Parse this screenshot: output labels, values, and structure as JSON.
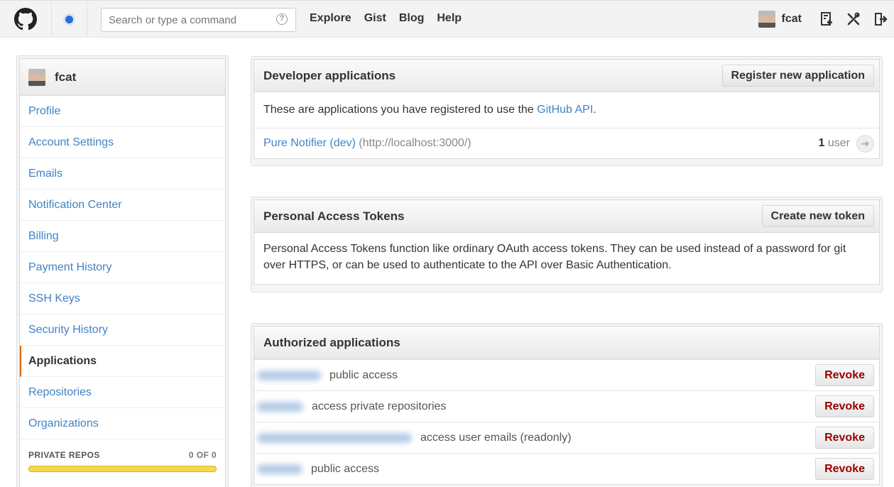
{
  "header": {
    "search_placeholder": "Search or type a command",
    "help_glyph": "?",
    "nav": [
      "Explore",
      "Gist",
      "Blog",
      "Help"
    ],
    "username": "fcat",
    "icons": [
      "github-logo-icon",
      "notification-dot-icon",
      "new-repo-icon",
      "settings-tools-icon",
      "sign-out-icon"
    ],
    "notification_color": "#2a6fd3"
  },
  "sidebar": {
    "username": "fcat",
    "items": [
      {
        "label": "Profile"
      },
      {
        "label": "Account Settings"
      },
      {
        "label": "Emails"
      },
      {
        "label": "Notification Center"
      },
      {
        "label": "Billing"
      },
      {
        "label": "Payment History"
      },
      {
        "label": "SSH Keys"
      },
      {
        "label": "Security History"
      },
      {
        "label": "Applications",
        "selected": true
      },
      {
        "label": "Repositories"
      },
      {
        "label": "Organizations"
      }
    ],
    "private_repos_label": "PRIVATE REPOS",
    "private_repos_count": "0 OF 0",
    "private_repos_usage": 0
  },
  "developer_apps": {
    "title": "Developer applications",
    "button": "Register new application",
    "intro_before": "These are applications you have registered to use the ",
    "intro_link": "GitHub API",
    "intro_after": ".",
    "app": {
      "name": "Pure Notifier (dev)",
      "url": "(http://localhost:3000/)",
      "user_count": "1",
      "user_label": "user",
      "arrow": "➜"
    }
  },
  "tokens": {
    "title": "Personal Access Tokens",
    "button": "Create new token",
    "description": "Personal Access Tokens function like ordinary OAuth access tokens. They can be used instead of a password for git over HTTPS, or can be used to authenticate to the API over Basic Authentication."
  },
  "authorized": {
    "title": "Authorized applications",
    "revoke_label": "Revoke",
    "rows": [
      {
        "scope": "public access"
      },
      {
        "scope": "access private repositories"
      },
      {
        "scope": "access user emails (readonly)"
      },
      {
        "scope": "public access"
      }
    ]
  }
}
